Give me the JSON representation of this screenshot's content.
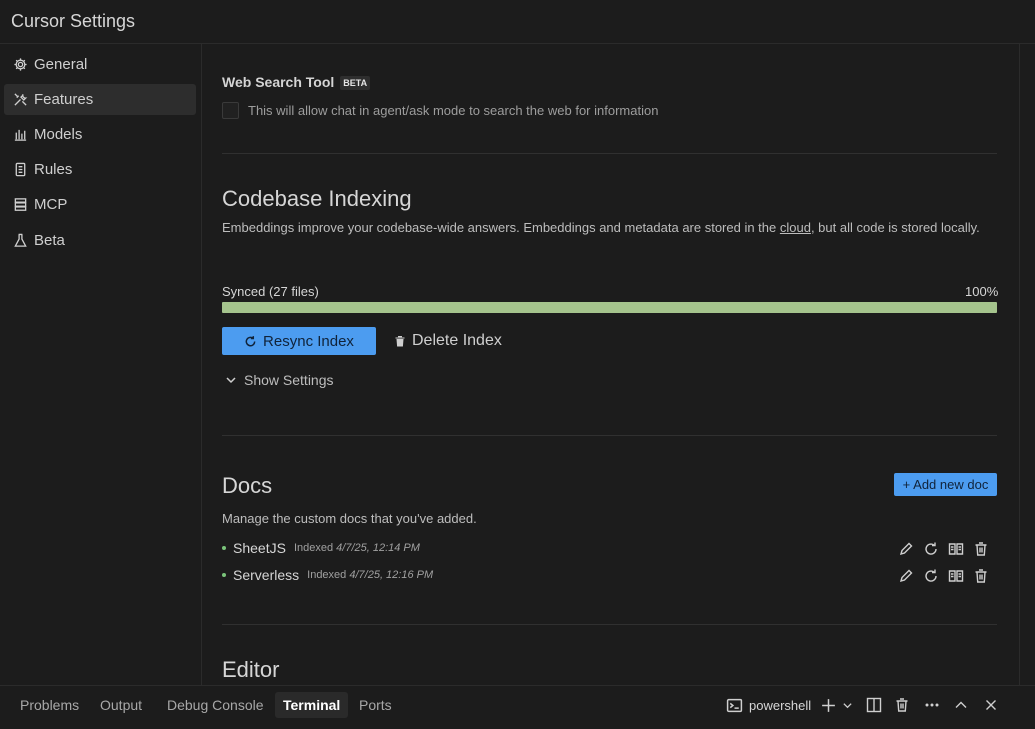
{
  "window": {
    "title": "Cursor Settings"
  },
  "sidebar": {
    "items": [
      {
        "label": "General",
        "icon": "gear-icon"
      },
      {
        "label": "Features",
        "icon": "tools-icon",
        "active": true
      },
      {
        "label": "Models",
        "icon": "bar-chart-icon"
      },
      {
        "label": "Rules",
        "icon": "document-icon"
      },
      {
        "label": "MCP",
        "icon": "server-icon"
      },
      {
        "label": "Beta",
        "icon": "flask-icon"
      }
    ]
  },
  "web_search": {
    "title": "Web Search Tool",
    "badge": "BETA",
    "checkbox_label": "This will allow chat in agent/ask mode to search the web for information",
    "checked": false
  },
  "indexing": {
    "title": "Codebase Indexing",
    "desc_before": "Embeddings improve your codebase-wide answers. Embeddings and metadata are stored in the ",
    "desc_link": "cloud",
    "desc_after": ", but all code is stored locally.",
    "status": "Synced (27 files)",
    "percent_label": "100%",
    "progress": 1.0,
    "resync_label": "Resync Index",
    "delete_label": "Delete Index",
    "show_settings_label": "Show Settings"
  },
  "docs": {
    "title": "Docs",
    "add_label": "+ Add new doc",
    "desc": "Manage the custom docs that you've added.",
    "items": [
      {
        "name": "SheetJS",
        "indexed_label": "Indexed",
        "indexed_date": "4/7/25, 12:14 PM"
      },
      {
        "name": "Serverless",
        "indexed_label": "Indexed",
        "indexed_date": "4/7/25, 12:16 PM"
      }
    ]
  },
  "editor": {
    "title": "Editor"
  },
  "panel": {
    "tabs": [
      "Problems",
      "Output",
      "Debug Console",
      "Terminal",
      "Ports"
    ],
    "active_tab": "Terminal",
    "shell_label": "powershell"
  },
  "colors": {
    "accent": "#4c9cf0",
    "progress": "#a5c48d",
    "status_dot": "#7ac47a",
    "background": "#1c1c1c"
  }
}
